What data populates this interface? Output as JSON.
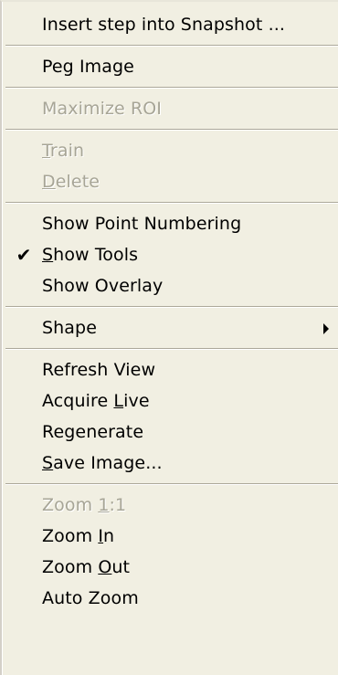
{
  "menu": {
    "groups": [
      [
        {
          "pre": "Insert step into Snapshot ...",
          "u": "",
          "post": "",
          "disabled": false
        }
      ],
      [
        {
          "pre": "Peg Image",
          "u": "",
          "post": "",
          "disabled": false
        }
      ],
      [
        {
          "pre": "Maximize ROI",
          "u": "",
          "post": "",
          "disabled": true
        }
      ],
      [
        {
          "pre": "",
          "u": "T",
          "post": "rain",
          "disabled": true
        },
        {
          "pre": "",
          "u": "D",
          "post": "elete",
          "disabled": true
        }
      ],
      [
        {
          "pre": "Show Point Numbering",
          "u": "",
          "post": "",
          "disabled": false
        },
        {
          "pre": "",
          "u": "S",
          "post": "how Tools",
          "disabled": false,
          "checked": true,
          "check_glyph": "✔"
        },
        {
          "pre": "Show Overlay",
          "u": "",
          "post": "",
          "disabled": false
        }
      ],
      [
        {
          "pre": "Shape",
          "u": "",
          "post": "",
          "disabled": false,
          "submenu": true
        }
      ],
      [
        {
          "pre": "Refresh View",
          "u": "",
          "post": "",
          "disabled": false
        },
        {
          "pre": "Acquire ",
          "u": "L",
          "post": "ive",
          "disabled": false
        },
        {
          "pre": "Regenerate",
          "u": "",
          "post": "",
          "disabled": false
        },
        {
          "pre": "",
          "u": "S",
          "post": "ave Image...",
          "disabled": false
        }
      ],
      [
        {
          "pre": "Zoom ",
          "u": "1",
          "post": ":1",
          "disabled": true
        },
        {
          "pre": "Zoom ",
          "u": "I",
          "post": "n",
          "disabled": false
        },
        {
          "pre": "Zoom ",
          "u": "O",
          "post": "ut",
          "disabled": false
        },
        {
          "pre": "Auto Zoom",
          "u": "",
          "post": "",
          "disabled": false
        }
      ]
    ]
  }
}
